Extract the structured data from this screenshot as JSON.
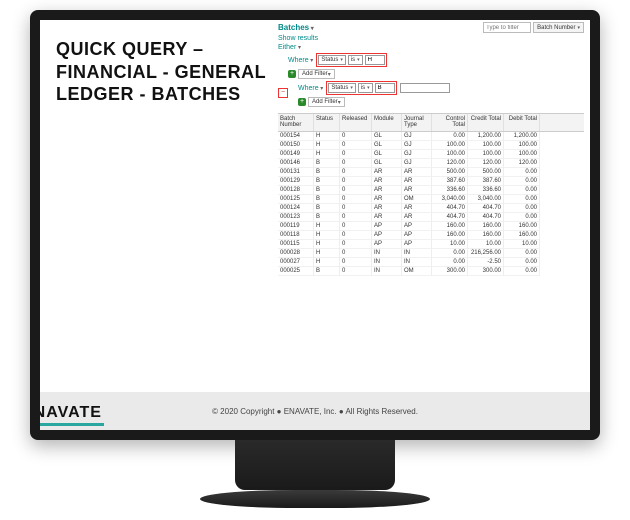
{
  "slide_title": "QUICK QUERY – FINANCIAL - GENERAL LEDGER - BATCHES",
  "brand": "ENAVATE",
  "copyright": "© 2020 Copyright ● ENAVATE, Inc. ● All Rights Reserved.",
  "header": {
    "tab": "Batches",
    "type_placeholder": "Type to filter",
    "sort_dropdown": "Batch Number"
  },
  "toolbar": {
    "show_results": "Show results",
    "either": "Either",
    "where": "Where",
    "add_filter": "Add Filter",
    "minus": "−",
    "plus": "+"
  },
  "filters": {
    "c1_field": "Status",
    "c1_op": "is",
    "c1_val": "H",
    "c2_field": "Status",
    "c2_op": "is",
    "c2_val": "B"
  },
  "columns": {
    "c0": "Batch Number",
    "c1": "Status",
    "c2": "Released",
    "c3": "Module",
    "c4": "Journal Type",
    "c5": "Control Total",
    "c6": "Credit Total",
    "c7": "Debit Total"
  },
  "rows": [
    {
      "bn": "000154",
      "st": "H",
      "rel": "0",
      "mod": "GL",
      "jt": "GJ",
      "ctl": "0.00",
      "cr": "1,200.00",
      "dr": "1,200.00"
    },
    {
      "bn": "000150",
      "st": "H",
      "rel": "0",
      "mod": "GL",
      "jt": "GJ",
      "ctl": "100.00",
      "cr": "100.00",
      "dr": "100.00"
    },
    {
      "bn": "000149",
      "st": "H",
      "rel": "0",
      "mod": "GL",
      "jt": "GJ",
      "ctl": "100.00",
      "cr": "100.00",
      "dr": "100.00"
    },
    {
      "bn": "000146",
      "st": "B",
      "rel": "0",
      "mod": "GL",
      "jt": "GJ",
      "ctl": "120.00",
      "cr": "120.00",
      "dr": "120.00"
    },
    {
      "bn": "000131",
      "st": "B",
      "rel": "0",
      "mod": "AR",
      "jt": "AR",
      "ctl": "500.00",
      "cr": "500.00",
      "dr": "0.00"
    },
    {
      "bn": "000129",
      "st": "B",
      "rel": "0",
      "mod": "AR",
      "jt": "AR",
      "ctl": "387.60",
      "cr": "387.60",
      "dr": "0.00"
    },
    {
      "bn": "000128",
      "st": "B",
      "rel": "0",
      "mod": "AR",
      "jt": "AR",
      "ctl": "336.60",
      "cr": "336.60",
      "dr": "0.00"
    },
    {
      "bn": "000125",
      "st": "B",
      "rel": "0",
      "mod": "AR",
      "jt": "OM",
      "ctl": "3,040.00",
      "cr": "3,040.00",
      "dr": "0.00"
    },
    {
      "bn": "000124",
      "st": "B",
      "rel": "0",
      "mod": "AR",
      "jt": "AR",
      "ctl": "404.70",
      "cr": "404.70",
      "dr": "0.00"
    },
    {
      "bn": "000123",
      "st": "B",
      "rel": "0",
      "mod": "AR",
      "jt": "AR",
      "ctl": "404.70",
      "cr": "404.70",
      "dr": "0.00"
    },
    {
      "bn": "000119",
      "st": "H",
      "rel": "0",
      "mod": "AP",
      "jt": "AP",
      "ctl": "160.00",
      "cr": "160.00",
      "dr": "160.00"
    },
    {
      "bn": "000118",
      "st": "H",
      "rel": "0",
      "mod": "AP",
      "jt": "AP",
      "ctl": "160.00",
      "cr": "160.00",
      "dr": "160.00"
    },
    {
      "bn": "000115",
      "st": "H",
      "rel": "0",
      "mod": "AP",
      "jt": "AP",
      "ctl": "10.00",
      "cr": "10.00",
      "dr": "10.00"
    },
    {
      "bn": "000028",
      "st": "H",
      "rel": "0",
      "mod": "IN",
      "jt": "IN",
      "ctl": "0.00",
      "cr": "216,256.00",
      "dr": "0.00"
    },
    {
      "bn": "000027",
      "st": "H",
      "rel": "0",
      "mod": "IN",
      "jt": "IN",
      "ctl": "0.00",
      "cr": "-2.50",
      "dr": "0.00"
    },
    {
      "bn": "000025",
      "st": "B",
      "rel": "0",
      "mod": "IN",
      "jt": "OM",
      "ctl": "300.00",
      "cr": "300.00",
      "dr": "0.00"
    }
  ]
}
